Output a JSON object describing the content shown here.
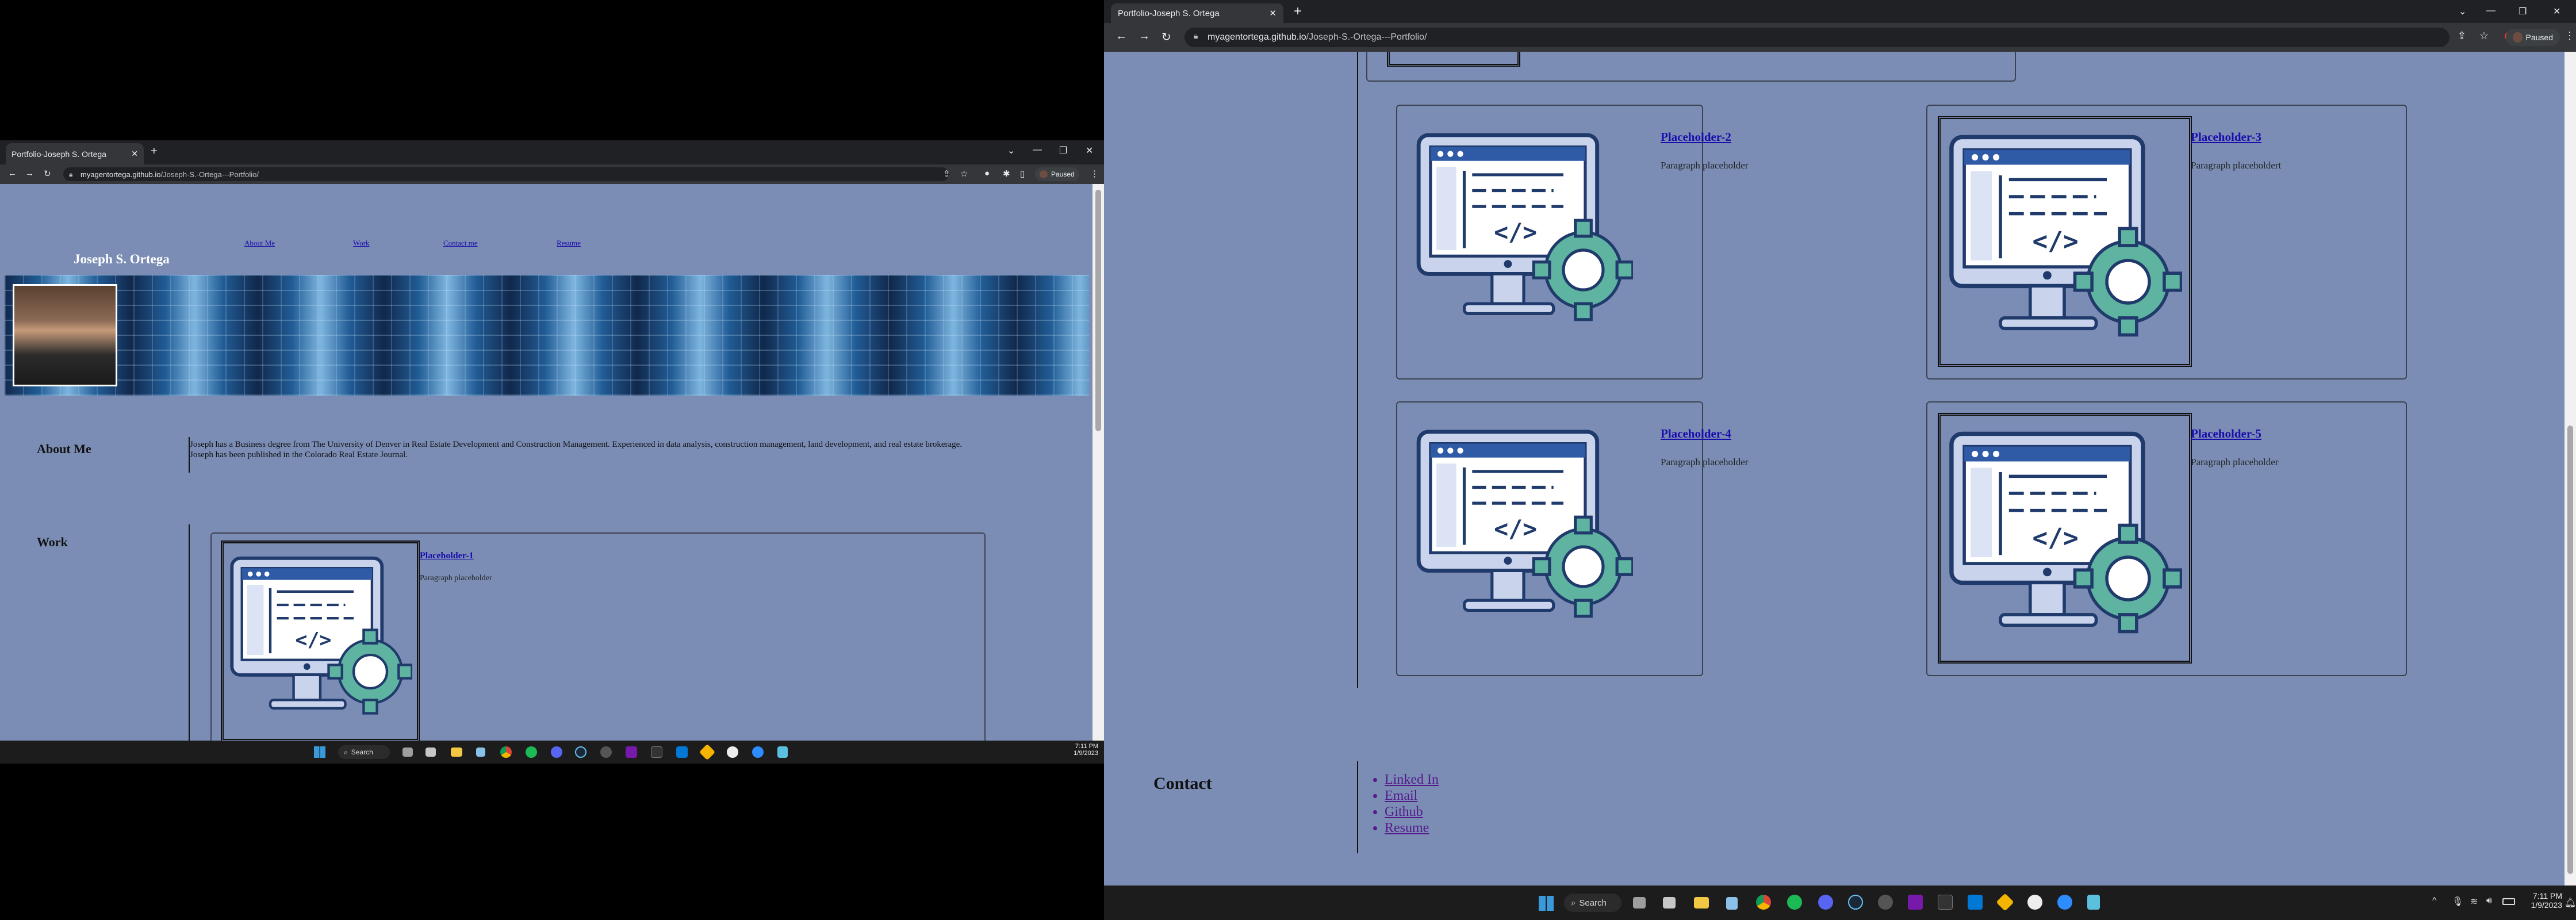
{
  "browser": {
    "tab_title": "Portfolio-Joseph S. Ortega",
    "url_host": "myagentortega.github.io",
    "url_path": "/Joseph-S.-Ortega---Portfolio/",
    "profile_label": "Paused"
  },
  "site": {
    "name": "Joseph S. Ortega",
    "nav": [
      "About Me",
      "Work",
      "Contact me",
      "Resume"
    ],
    "about": {
      "heading": "About Me",
      "text": "Joseph has a Business degree from The University of Denver in Real Estate Development and Construction Management. Experienced in data analysis, construction management, land development, and real estate brokerage. Joseph has been published in the Colorado Real Estate Journal."
    },
    "work": {
      "heading": "Work",
      "projects": [
        {
          "title": "Placeholder-1",
          "text": "Paragraph placeholder"
        },
        {
          "title": "Placeholder-2",
          "text": "Paragraph placeholder"
        },
        {
          "title": "Placeholder-3",
          "text": "Paragraph placeholdert"
        },
        {
          "title": "Placeholder-4",
          "text": "Paragraph placeholder"
        },
        {
          "title": "Placeholder-5",
          "text": "Paragraph placeholder"
        }
      ]
    },
    "contact": {
      "heading": "Contact",
      "links": [
        "Linked In",
        "Email",
        "Github",
        "Resume"
      ]
    }
  },
  "taskbar": {
    "search_label": "Search",
    "left_time": "7:11 PM",
    "left_date": "1/9/2023",
    "right_time": "7:11 PM",
    "right_date": "1/9/2023"
  },
  "colors": {
    "page_bg": "#7b8db5",
    "link": "#1a0dab",
    "visited_link": "#551a8b",
    "chrome_dark": "#202124",
    "chrome_toolbar": "#35363a",
    "teal_gear": "#5fb3a1"
  }
}
